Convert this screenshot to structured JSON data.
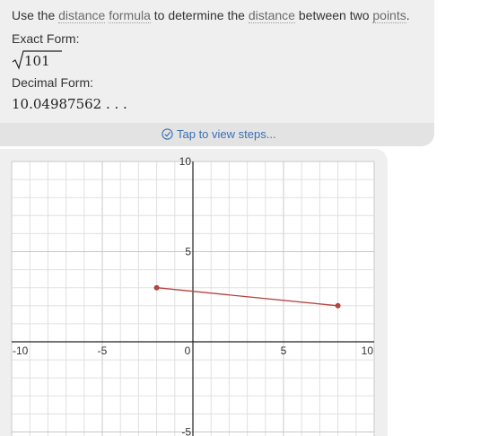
{
  "answer": {
    "intro": {
      "prefix": "Use the ",
      "term1": "distance",
      "term2": "formula",
      "middle": " to determine the ",
      "term3": "distance",
      "middle2": " between two ",
      "term4": "points",
      "suffix": "."
    },
    "exact_label": "Exact Form:",
    "exact_value": "101",
    "decimal_label": "Decimal Form:",
    "decimal_value": "10.04987562 . . .",
    "steps_label": "Tap to view steps..."
  },
  "colors": {
    "link": "#3b6fb5",
    "segment": "#b5433e",
    "grid_minor": "#e0e0e0",
    "grid_major": "#c8c8c8"
  },
  "chart_data": {
    "type": "line",
    "xlim": [
      -10,
      10
    ],
    "ylim": [
      -5,
      10
    ],
    "x_ticks": [
      -10,
      -5,
      0,
      5,
      10
    ],
    "y_ticks": [
      10,
      5,
      -5
    ],
    "grid": true,
    "series": [
      {
        "x": [
          -2,
          8
        ],
        "y": [
          3,
          2
        ]
      }
    ]
  }
}
